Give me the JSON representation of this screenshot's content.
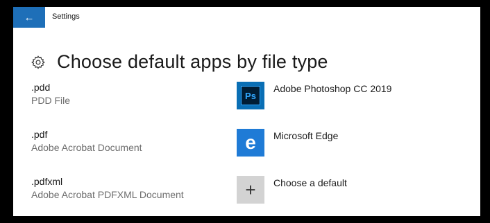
{
  "window": {
    "title": "Settings",
    "back_glyph": "←"
  },
  "page": {
    "title": "Choose default apps by file type",
    "icon": "gear-icon"
  },
  "rows": [
    {
      "extension": ".pdd",
      "description": "PDD File",
      "app": {
        "name": "Adobe Photoshop CC 2019",
        "icon": "photoshop-icon",
        "icon_text": "Ps"
      }
    },
    {
      "extension": ".pdf",
      "description": "Adobe Acrobat Document",
      "app": {
        "name": "Microsoft Edge",
        "icon": "edge-icon",
        "icon_text": "e"
      }
    },
    {
      "extension": ".pdfxml",
      "description": "Adobe Acrobat PDFXML Document",
      "app": {
        "name": "Choose a default",
        "icon": "plus-icon",
        "icon_text": "+"
      }
    }
  ],
  "colors": {
    "accent": "#1e6fb8",
    "photoshop": "#0a6fb5",
    "edge": "#1f7bd6",
    "add_tile": "#d3d3d3"
  }
}
